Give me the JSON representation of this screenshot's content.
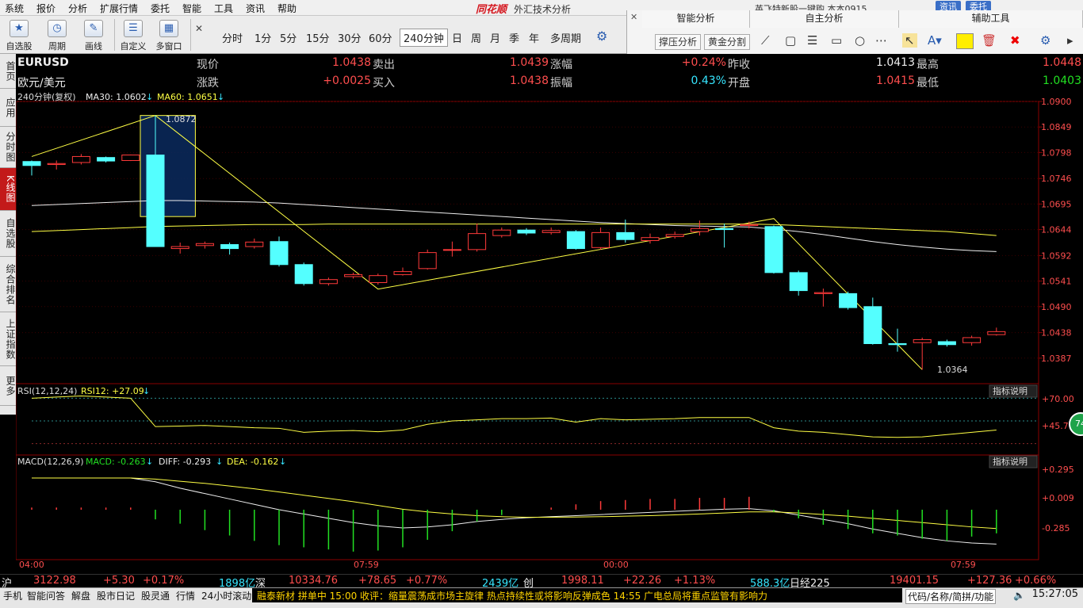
{
  "menu": [
    "系统",
    "报价",
    "分析",
    "扩展行情",
    "委托",
    "智能",
    "工具",
    "资讯",
    "帮助"
  ],
  "app": {
    "brand": "同花顺",
    "title": "外汇技术分析",
    "promo": "英飞特新股一键购  本本0915",
    "btn_news": "资讯",
    "btn_trade": "委托"
  },
  "toolbar": {
    "tools": [
      {
        "label": "自选股",
        "icon": "star-icon"
      },
      {
        "label": "周期",
        "icon": "cycle-icon"
      },
      {
        "label": "画线",
        "icon": "pen-icon"
      },
      {
        "label": "自定义",
        "icon": "checklist-icon"
      },
      {
        "label": "多窗口",
        "icon": "grid-icon"
      }
    ],
    "periods": [
      "分时",
      "1分",
      "5分",
      "15分",
      "30分",
      "60分",
      "240分钟",
      "日",
      "周",
      "月",
      "季",
      "年",
      "多周期"
    ],
    "active_period": "240分钟",
    "panels": [
      "智能分析",
      "自主分析",
      "辅助工具"
    ],
    "smart_buttons": [
      "撑压分析",
      "黄金分割"
    ],
    "highlight_color": "#ffee00"
  },
  "sidebar": [
    {
      "label": "首页",
      "active": false
    },
    {
      "label": "应用",
      "active": false
    },
    {
      "label": "分时图",
      "active": false
    },
    {
      "label": "K线图",
      "active": true
    },
    {
      "label": "自选股",
      "active": false
    },
    {
      "label": "综合排名",
      "active": false
    },
    {
      "label": "上证指数",
      "active": false
    },
    {
      "label": "更多",
      "active": false
    }
  ],
  "quote": {
    "code": "EURUSD",
    "name": "欧元/美元",
    "rows": [
      [
        {
          "label": "现价",
          "value": "1.0438",
          "color": "red"
        },
        {
          "label": "卖出",
          "value": "1.0439",
          "color": "red"
        },
        {
          "label": "涨幅",
          "value": "+0.24%",
          "color": "red"
        },
        {
          "label": "昨收",
          "value": "1.0413",
          "color": "white"
        },
        {
          "label": "最高",
          "value": "1.0448",
          "color": "red"
        }
      ],
      [
        {
          "label": "涨跌",
          "value": "+0.0025",
          "color": "red"
        },
        {
          "label": "买入",
          "value": "1.0438",
          "color": "red"
        },
        {
          "label": "振幅",
          "value": "0.43%",
          "color": "cyan"
        },
        {
          "label": "开盘",
          "value": "1.0415",
          "color": "red"
        },
        {
          "label": "最低",
          "value": "1.0403",
          "color": "green"
        }
      ]
    ]
  },
  "main_chart": {
    "header": {
      "period": "240分钟(复权)",
      "ma30": "MA30: 1.0602",
      "ma60": "MA60: 1.0651",
      "arrow": "↓"
    },
    "y_ticks": [
      "1.0900",
      "1.0849",
      "1.0798",
      "1.0746",
      "1.0695",
      "1.0644",
      "1.0592",
      "1.0541",
      "1.0490",
      "1.0438",
      "1.0387"
    ],
    "high_label": "1.0872",
    "low_label": "1.0364"
  },
  "rsi": {
    "header": "RSI(12,12,24)",
    "value": "RSI12: +27.09",
    "arrow": "↓",
    "ticks": [
      "+70.00",
      "+45.70"
    ],
    "btn": "指标说明",
    "badge": "74"
  },
  "macd": {
    "header": "MACD(12,26,9)",
    "macd": "MACD: -0.263",
    "diff": "DIFF: -0.293",
    "dea": "DEA: -0.162",
    "arrow": "↓",
    "ticks": [
      "+0.295",
      "+0.009",
      "-0.285"
    ],
    "btn": "指标说明"
  },
  "x_ticks": [
    "04:00",
    "07:59",
    "00:00",
    "07:59"
  ],
  "chart_data": {
    "type": "candlestick",
    "y_range": [
      1.0336,
      1.09
    ],
    "candles": [
      {
        "o": 1.078,
        "c": 1.0772,
        "h": 1.0782,
        "l": 1.0752
      },
      {
        "o": 1.0774,
        "c": 1.0776,
        "h": 1.0782,
        "l": 1.0764
      },
      {
        "o": 1.0778,
        "c": 1.079,
        "h": 1.0795,
        "l": 1.0774
      },
      {
        "o": 1.0788,
        "c": 1.0781,
        "h": 1.079,
        "l": 1.0778
      },
      {
        "o": 1.0782,
        "c": 1.0793,
        "h": 1.0794,
        "l": 1.0781
      },
      {
        "o": 1.0793,
        "c": 1.061,
        "h": 1.0872,
        "l": 1.061
      },
      {
        "o": 1.0606,
        "c": 1.061,
        "h": 1.0618,
        "l": 1.0596
      },
      {
        "o": 1.0612,
        "c": 1.0616,
        "h": 1.062,
        "l": 1.0606
      },
      {
        "o": 1.0614,
        "c": 1.0606,
        "h": 1.0618,
        "l": 1.0594
      },
      {
        "o": 1.061,
        "c": 1.0619,
        "h": 1.0626,
        "l": 1.0606
      },
      {
        "o": 1.062,
        "c": 1.0574,
        "h": 1.063,
        "l": 1.057
      },
      {
        "o": 1.0574,
        "c": 1.0536,
        "h": 1.0578,
        "l": 1.0532
      },
      {
        "o": 1.0536,
        "c": 1.0544,
        "h": 1.0548,
        "l": 1.0532
      },
      {
        "o": 1.055,
        "c": 1.0554,
        "h": 1.0558,
        "l": 1.0546
      },
      {
        "o": 1.0538,
        "c": 1.0552,
        "h": 1.0556,
        "l": 1.0534
      },
      {
        "o": 1.0554,
        "c": 1.056,
        "h": 1.0568,
        "l": 1.0552
      },
      {
        "o": 1.0566,
        "c": 1.0598,
        "h": 1.0604,
        "l": 1.0564
      },
      {
        "o": 1.0604,
        "c": 1.0604,
        "h": 1.062,
        "l": 1.059
      },
      {
        "o": 1.0604,
        "c": 1.0636,
        "h": 1.0656,
        "l": 1.06
      },
      {
        "o": 1.0632,
        "c": 1.0643,
        "h": 1.0648,
        "l": 1.0628
      },
      {
        "o": 1.0643,
        "c": 1.0637,
        "h": 1.0647,
        "l": 1.0633
      },
      {
        "o": 1.0638,
        "c": 1.0642,
        "h": 1.0648,
        "l": 1.0634
      },
      {
        "o": 1.064,
        "c": 1.0606,
        "h": 1.0643,
        "l": 1.0604
      },
      {
        "o": 1.0608,
        "c": 1.0638,
        "h": 1.0648,
        "l": 1.0604
      },
      {
        "o": 1.0638,
        "c": 1.0624,
        "h": 1.0664,
        "l": 1.0618
      },
      {
        "o": 1.0622,
        "c": 1.0628,
        "h": 1.0636,
        "l": 1.0616
      },
      {
        "o": 1.063,
        "c": 1.0634,
        "h": 1.064,
        "l": 1.0626
      },
      {
        "o": 1.064,
        "c": 1.0646,
        "h": 1.0662,
        "l": 1.0632
      },
      {
        "o": 1.0646,
        "c": 1.0644,
        "h": 1.0656,
        "l": 1.0608
      },
      {
        "o": 1.0652,
        "c": 1.0654,
        "h": 1.066,
        "l": 1.0646
      },
      {
        "o": 1.065,
        "c": 1.0558,
        "h": 1.0652,
        "l": 1.0556
      },
      {
        "o": 1.0558,
        "c": 1.0522,
        "h": 1.0562,
        "l": 1.0512
      },
      {
        "o": 1.0516,
        "c": 1.0518,
        "h": 1.0526,
        "l": 1.049
      },
      {
        "o": 1.0516,
        "c": 1.0488,
        "h": 1.052,
        "l": 1.0484
      },
      {
        "o": 1.049,
        "c": 1.0416,
        "h": 1.0508,
        "l": 1.0414
      },
      {
        "o": 1.0416,
        "c": 1.0414,
        "h": 1.0446,
        "l": 1.04
      },
      {
        "o": 1.0418,
        "c": 1.0424,
        "h": 1.0428,
        "l": 1.0364
      },
      {
        "o": 1.042,
        "c": 1.0414,
        "h": 1.0424,
        "l": 1.041
      },
      {
        "o": 1.0418,
        "c": 1.0428,
        "h": 1.0432,
        "l": 1.0412
      },
      {
        "o": 1.0434,
        "c": 1.044,
        "h": 1.0448,
        "l": 1.0432
      }
    ],
    "ma30": [
      1.0692,
      1.0694,
      1.0696,
      1.0698,
      1.07,
      1.0702,
      1.0702,
      1.0701,
      1.07,
      1.0699,
      1.0697,
      1.0694,
      1.0691,
      1.0688,
      1.0685,
      1.0682,
      1.0679,
      1.0676,
      1.0673,
      1.067,
      1.0667,
      1.0664,
      1.0661,
      1.0658,
      1.0656,
      1.0654,
      1.0652,
      1.0651,
      1.065,
      1.0649,
      1.0645,
      1.064,
      1.0634,
      1.0627,
      1.062,
      1.0614,
      1.0609,
      1.0605,
      1.0602,
      1.06
    ],
    "ma60": [
      1.064,
      1.0642,
      1.0644,
      1.0646,
      1.0648,
      1.065,
      1.0651,
      1.0652,
      1.0653,
      1.0654,
      1.0654,
      1.0654,
      1.0655,
      1.0655,
      1.0655,
      1.0655,
      1.0655,
      1.0655,
      1.0655,
      1.0655,
      1.0655,
      1.0655,
      1.0655,
      1.0655,
      1.0655,
      1.0655,
      1.0655,
      1.0655,
      1.0655,
      1.0655,
      1.0654,
      1.0652,
      1.065,
      1.0648,
      1.0646,
      1.0644,
      1.0642,
      1.064,
      1.0636,
      1.0632
    ],
    "zigzag": [
      [
        0,
        1.079
      ],
      [
        5,
        1.0872
      ],
      [
        14,
        1.0525
      ],
      [
        30,
        1.0666
      ],
      [
        36,
        1.0364
      ]
    ],
    "box": [
      5,
      7,
      1.0872,
      1.067
    ],
    "rsi_range": [
      20,
      80
    ],
    "rsi12": [
      70,
      71,
      72,
      71,
      70,
      45,
      45.5,
      46,
      45,
      44,
      43.5,
      40,
      41,
      41.5,
      40.5,
      42,
      47,
      50,
      51,
      52,
      52,
      52.5,
      49,
      52,
      51,
      51.5,
      52,
      53,
      53,
      53,
      44,
      41,
      40,
      38,
      36,
      35.5,
      36,
      38,
      40,
      42
    ],
    "macd_range": [
      -0.45,
      0.45
    ],
    "diff": [
      0.295,
      0.295,
      0.295,
      0.295,
      0.295,
      0.26,
      0.2,
      0.15,
      0.1,
      0.05,
      0.0,
      -0.04,
      -0.08,
      -0.12,
      -0.15,
      -0.17,
      -0.16,
      -0.14,
      -0.11,
      -0.09,
      -0.075,
      -0.065,
      -0.055,
      -0.045,
      -0.035,
      -0.025,
      -0.015,
      -0.005,
      0.005,
      0.01,
      -0.01,
      -0.05,
      -0.09,
      -0.13,
      -0.18,
      -0.22,
      -0.26,
      -0.29,
      -0.31,
      -0.32
    ],
    "dea": [
      0.295,
      0.295,
      0.295,
      0.295,
      0.295,
      0.285,
      0.265,
      0.245,
      0.22,
      0.195,
      0.165,
      0.135,
      0.105,
      0.075,
      0.04,
      0.005,
      -0.02,
      -0.04,
      -0.055,
      -0.065,
      -0.07,
      -0.07,
      -0.068,
      -0.065,
      -0.06,
      -0.055,
      -0.048,
      -0.04,
      -0.03,
      -0.02,
      -0.02,
      -0.03,
      -0.045,
      -0.06,
      -0.08,
      -0.1,
      -0.12,
      -0.14,
      -0.16,
      -0.175
    ],
    "macd_hist": [
      0.02,
      0.02,
      0.02,
      0.02,
      0.02,
      -0.09,
      -0.13,
      -0.19,
      -0.24,
      -0.29,
      -0.33,
      -0.35,
      -0.37,
      -0.39,
      -0.38,
      -0.35,
      -0.28,
      -0.2,
      -0.11,
      -0.05,
      0.0,
      0.02,
      0.05,
      0.08,
      0.09,
      0.1,
      0.1,
      0.11,
      0.11,
      0.12,
      -0.02,
      -0.08,
      -0.14,
      -0.18,
      -0.22,
      -0.24,
      -0.27,
      -0.29,
      -0.25,
      -0.22
    ]
  },
  "ticker": [
    {
      "text": "沪",
      "color": "white"
    },
    {
      "text": "3122.98",
      "color": "red"
    },
    {
      "text": "+5.30",
      "color": "red"
    },
    {
      "text": "+0.17%",
      "color": "red"
    },
    {
      "text": "1898亿",
      "color": "cyan"
    },
    {
      "text": "深",
      "color": "white"
    },
    {
      "text": "10334.76",
      "color": "red"
    },
    {
      "text": "+78.65",
      "color": "red"
    },
    {
      "text": "+0.77%",
      "color": "red"
    },
    {
      "text": "2439亿",
      "color": "cyan"
    },
    {
      "text": "创",
      "color": "white"
    },
    {
      "text": "1998.11",
      "color": "red"
    },
    {
      "text": "+22.26",
      "color": "red"
    },
    {
      "text": "+1.13%",
      "color": "red"
    },
    {
      "text": "588.3亿",
      "color": "cyan"
    },
    {
      "text": "日经225",
      "color": "white"
    },
    {
      "text": "19401.15",
      "color": "red"
    },
    {
      "text": "+127.36",
      "color": "red"
    },
    {
      "text": "+0.66%",
      "color": "red"
    }
  ],
  "status": {
    "items": [
      "手机",
      "智能问答",
      "解盘",
      "股市日记",
      "股灵通",
      "行情",
      "24小时滚动"
    ],
    "news": "融泰新材 拼单中      15:00 收评：缩量震荡成市场主旋律 热点持续性或将影响反弹成色               14:55 广电总局将重点监管有影响力",
    "search_hint": "代码/名称/简拼/功能",
    "time": "15:27:05"
  }
}
